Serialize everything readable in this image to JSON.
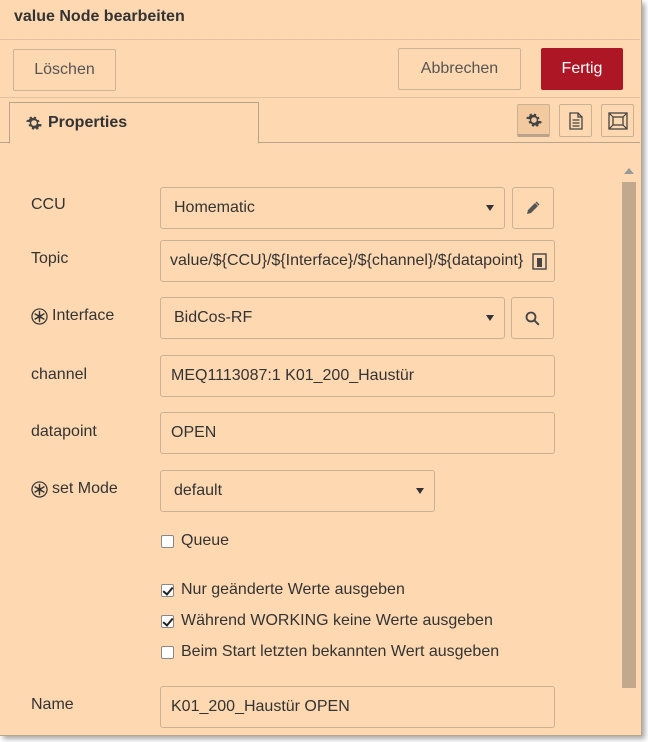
{
  "dialog": {
    "title": "value Node bearbeiten",
    "buttons": {
      "delete": "Löschen",
      "cancel": "Abbrechen",
      "done": "Fertig"
    },
    "tab": {
      "label": "Properties",
      "icon": "gear-icon"
    },
    "tab_icons": [
      "gear-icon",
      "document-icon",
      "frame-icon"
    ],
    "accent_color": "#ad1625"
  },
  "form": {
    "ccu": {
      "label": "CCU",
      "value": "Homematic",
      "button_icon": "pencil-icon"
    },
    "topic": {
      "label": "Topic",
      "value": "value/${CCU}/${Interface}/${channel}/${datapoint}",
      "icon": "variable-icon"
    },
    "interface": {
      "label": "Interface",
      "icon": "snowflake-icon",
      "value": "BidCos-RF",
      "button_icon": "search-icon"
    },
    "channel": {
      "label": "channel",
      "value": "MEQ1113087:1 K01_200_Haustür"
    },
    "datapoint": {
      "label": "datapoint",
      "value": "OPEN"
    },
    "set_mode": {
      "label": "set Mode",
      "icon": "snowflake-icon",
      "value": "default"
    },
    "queue": {
      "label": "Queue",
      "checked": false
    },
    "changes_only": {
      "label": "Nur geänderte Werte ausgeben",
      "checked": true
    },
    "working": {
      "label": "Während WORKING keine Werte ausgeben",
      "checked": true
    },
    "on_start": {
      "label": "Beim Start letzten bekannten Wert ausgeben",
      "checked": false
    },
    "name": {
      "label": "Name",
      "value": "K01_200_Haustür OPEN"
    }
  }
}
